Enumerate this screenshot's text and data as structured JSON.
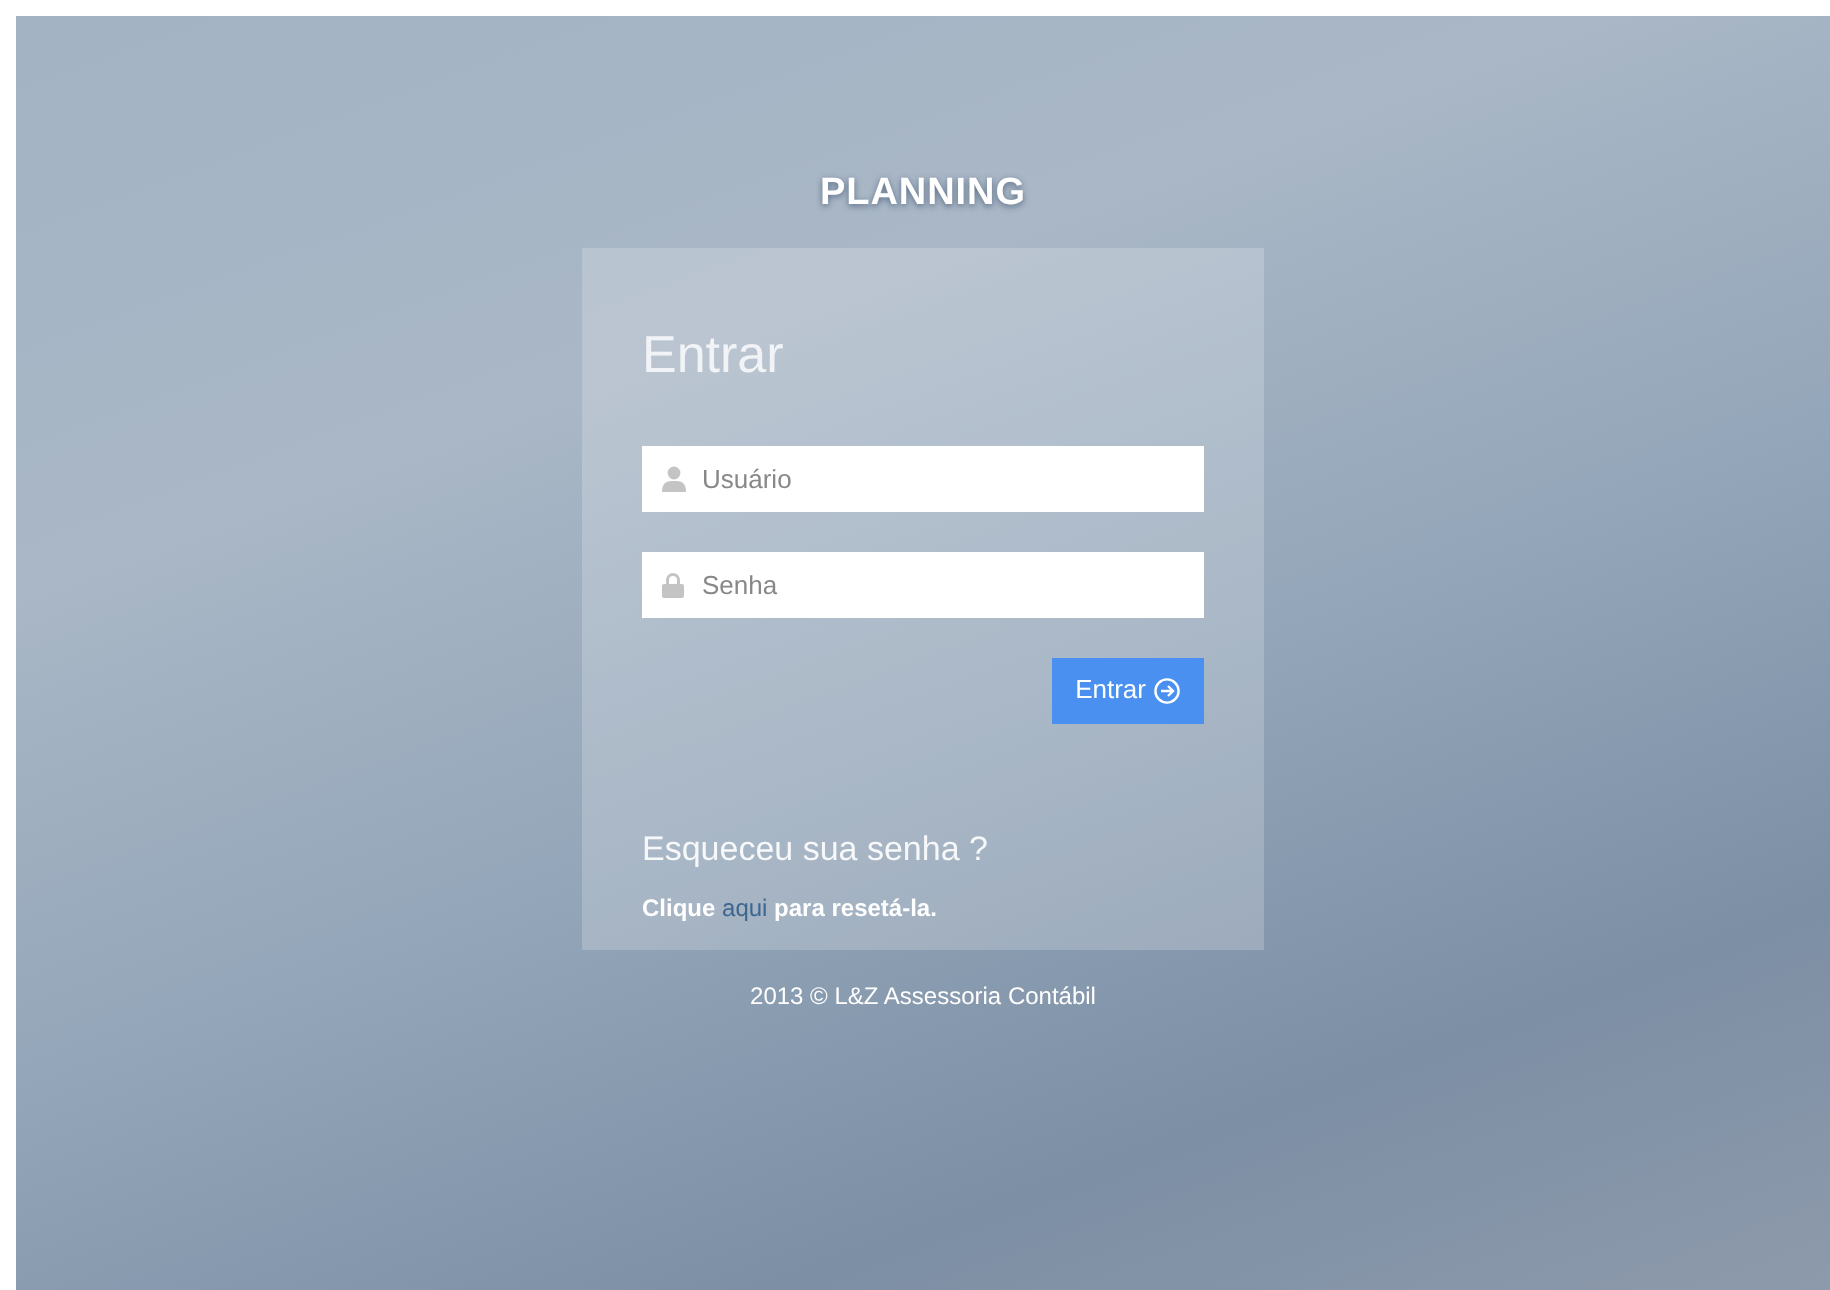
{
  "app_title": "PLANNING",
  "login": {
    "heading": "Entrar",
    "fields": [
      {
        "kind": "user",
        "placeholder": "Usuário"
      },
      {
        "kind": "password",
        "placeholder": "Senha"
      }
    ],
    "submit": {
      "label": "Entrar"
    }
  },
  "forgot": {
    "heading": "Esqueceu sua senha ?",
    "before": "Clique",
    "link": "aqui",
    "after": "para resetá-la."
  },
  "footer": "2013 © L&Z Assessoria Contábil"
}
